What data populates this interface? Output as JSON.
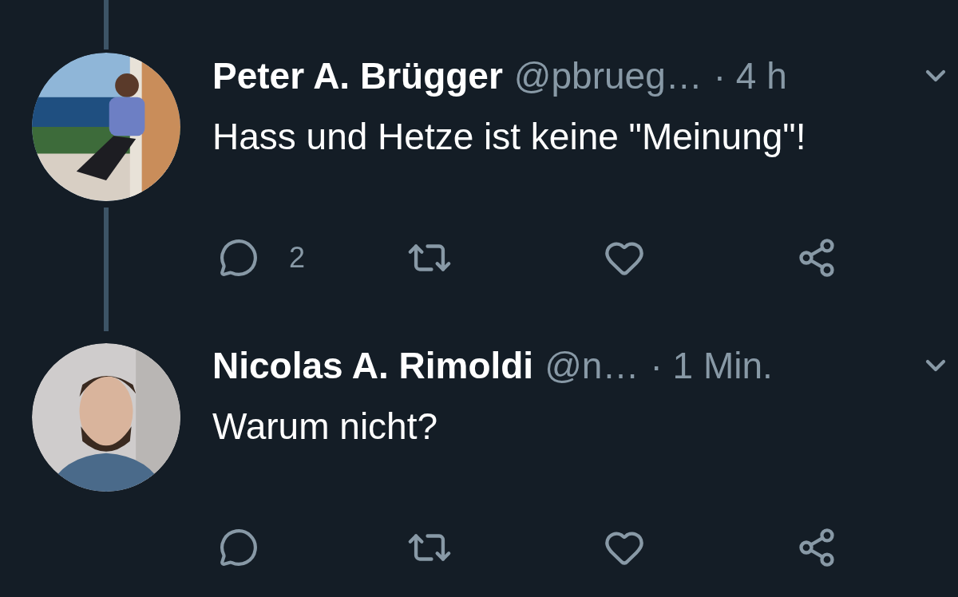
{
  "tweets": [
    {
      "name": "Peter A. Brügger",
      "handle": "@pbrueg…",
      "time": "· 4 h",
      "text": "Hass und Hetze ist keine \"Meinung\"!",
      "reply_count": "2",
      "thread_above": true,
      "thread_below": true
    },
    {
      "name": "Nicolas A. Rimoldi",
      "handle": "@n…",
      "time": "· 1 Min.",
      "text": "Warum nicht?",
      "thread_above": false,
      "thread_below": false
    }
  ]
}
